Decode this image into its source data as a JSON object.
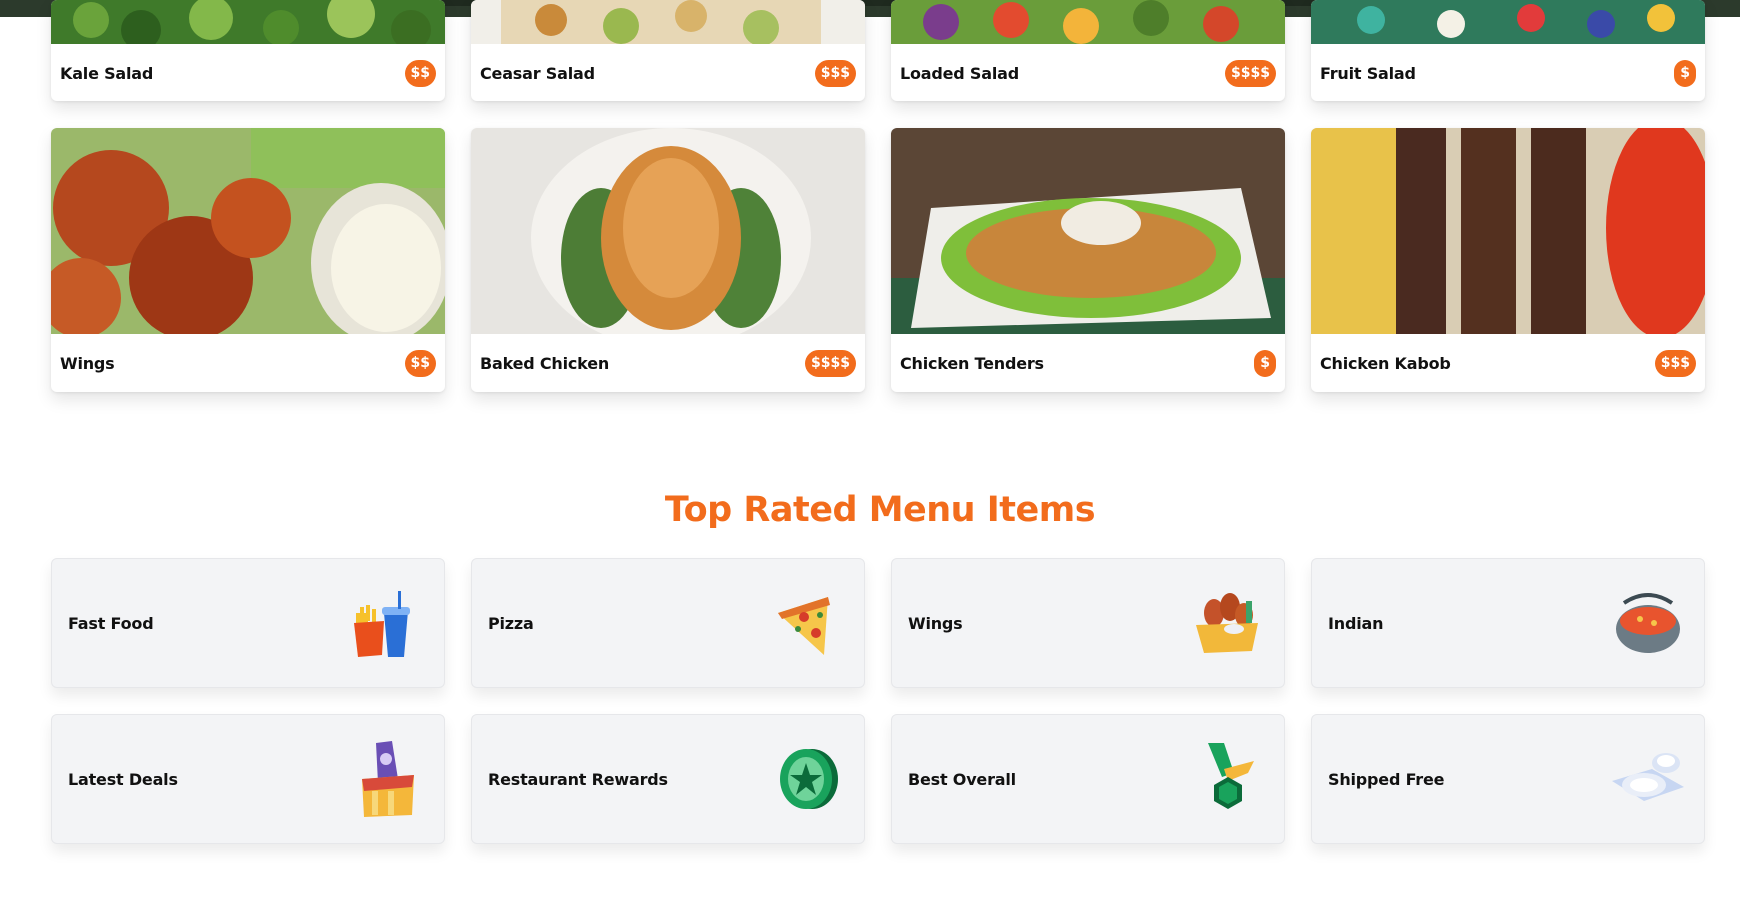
{
  "top_row": [
    {
      "name": "Kale Salad",
      "price": "$$"
    },
    {
      "name": "Ceasar Salad",
      "price": "$$$"
    },
    {
      "name": "Loaded Salad",
      "price": "$$$$"
    },
    {
      "name": "Fruit Salad",
      "price": "$"
    }
  ],
  "second_row": [
    {
      "name": "Wings",
      "price": "$$"
    },
    {
      "name": "Baked Chicken",
      "price": "$$$$"
    },
    {
      "name": "Chicken Tenders",
      "price": "$"
    },
    {
      "name": "Chicken Kabob",
      "price": "$$$"
    }
  ],
  "section": {
    "title": "Top Rated Menu Items"
  },
  "categories": [
    {
      "label": "Fast Food",
      "icon": "fast-food-icon"
    },
    {
      "label": "Pizza",
      "icon": "pizza-slice-icon"
    },
    {
      "label": "Wings",
      "icon": "wings-basket-icon"
    },
    {
      "label": "Indian",
      "icon": "curry-bowl-icon"
    },
    {
      "label": "Latest Deals",
      "icon": "deal-tag-icon"
    },
    {
      "label": "Restaurant Rewards",
      "icon": "reward-coin-icon"
    },
    {
      "label": "Best Overall",
      "icon": "award-medal-icon"
    },
    {
      "label": "Shipped Free",
      "icon": "plates-icon"
    }
  ],
  "colors": {
    "accent": "#f26c1c",
    "card_bg": "#f3f4f6"
  }
}
